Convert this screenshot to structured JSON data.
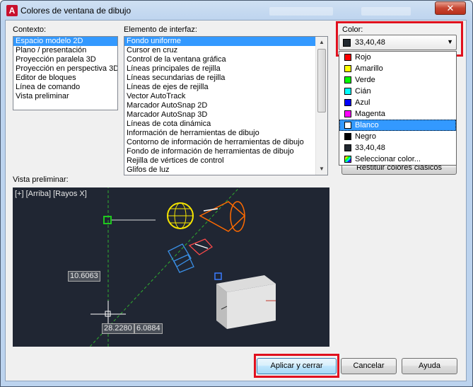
{
  "window": {
    "title": "Colores de ventana de dibujo",
    "app_icon_letter": "A",
    "close_glyph": "✕"
  },
  "context": {
    "label": "Contexto:",
    "items": [
      "Espacio modelo 2D",
      "Plano / presentación",
      "Proyección paralela 3D",
      "Proyección en perspectiva 3D",
      "Editor de bloques",
      "Línea de comando",
      "Vista preliminar"
    ],
    "selected_index": 0
  },
  "interface": {
    "label": "Elemento de interfaz:",
    "items": [
      "Fondo uniforme",
      "Cursor en cruz",
      "Control de la ventana gráfica",
      "Líneas principales de rejilla",
      "Líneas secundarias de rejilla",
      "Líneas de ejes de rejilla",
      "Vector AutoTrack",
      "Marcador AutoSnap 2D",
      "Marcador AutoSnap 3D",
      "Líneas de cota dinámica",
      "Información de herramientas de dibujo",
      "Contorno de información de herramientas de dibujo",
      "Fondo de información de herramientas de dibujo",
      "Rejilla de vértices de control",
      "Glifos de luz"
    ],
    "selected_index": 0
  },
  "color": {
    "label": "Color:",
    "current_value": "33,40,48",
    "current_swatch": "#212830",
    "options": [
      {
        "label": "Rojo",
        "swatch": "#ff0000"
      },
      {
        "label": "Amarillo",
        "swatch": "#ffff00"
      },
      {
        "label": "Verde",
        "swatch": "#00ff00"
      },
      {
        "label": "Cián",
        "swatch": "#00ffff"
      },
      {
        "label": "Azul",
        "swatch": "#0000ff"
      },
      {
        "label": "Magenta",
        "swatch": "#ff00ff"
      },
      {
        "label": "Blanco",
        "swatch": "#ffffff"
      },
      {
        "label": "Negro",
        "swatch": "#000000"
      },
      {
        "label": "33,40,48",
        "swatch": "#212830"
      },
      {
        "label": "Seleccionar color...",
        "swatch": "multicolor"
      }
    ],
    "highlighted_index": 6
  },
  "restore_classic_label": "Restituir colores clásicos",
  "preview": {
    "label": "Vista preliminar:",
    "viewport_label": "[+] [Arriba] [Rayos X]",
    "dim_value_1": "10.6063",
    "dim_value_2": "28.2280",
    "dim_value_3": "6.0884"
  },
  "buttons": {
    "apply_close": "Aplicar y cerrar",
    "cancel": "Cancelar",
    "help": "Ayuda"
  },
  "accent_colors": {
    "highlight": "#e0101e",
    "selection": "#3399ff"
  }
}
